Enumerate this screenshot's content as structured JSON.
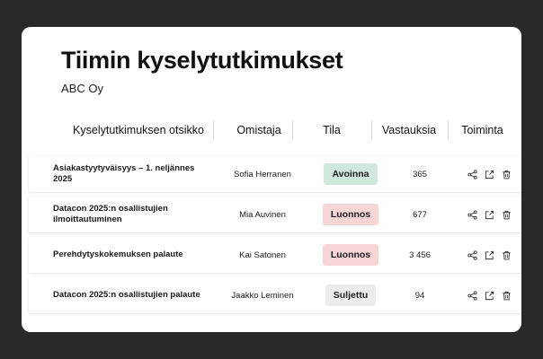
{
  "page": {
    "title": "Tiimin kyselytutkimukset",
    "subtitle": "ABC Oy"
  },
  "table": {
    "columns": [
      "Kyselytutkimuksen otsikko",
      "Omistaja",
      "Tila",
      "Vastauksia",
      "Toiminta"
    ],
    "rows": [
      {
        "title": "Asiakastyytyväisyys – 1. neljännes 2025",
        "owner": "Sofia Herranen",
        "status": "Avoinna",
        "responses": "365"
      },
      {
        "title": "Datacon 2025:n osallistujien ilmoittautuminen",
        "owner": "Mia Auvinen",
        "status": "Luonnos",
        "responses": "677"
      },
      {
        "title": "Perehdytyskokemuksen palaute",
        "owner": "Kai Satonen",
        "status": "Luonnos",
        "responses": "3 456"
      },
      {
        "title": "Datacon 2025:n osallistujien palaute",
        "owner": "Jaakko Leminen",
        "status": "Suljettu",
        "responses": "94"
      }
    ]
  },
  "status_colors": {
    "Avoinna": "#cfe8dc",
    "Luonnos": "#f6d5d5",
    "Suljettu": "#ececec"
  },
  "icons": [
    "share-icon",
    "export-icon",
    "trash-icon"
  ]
}
